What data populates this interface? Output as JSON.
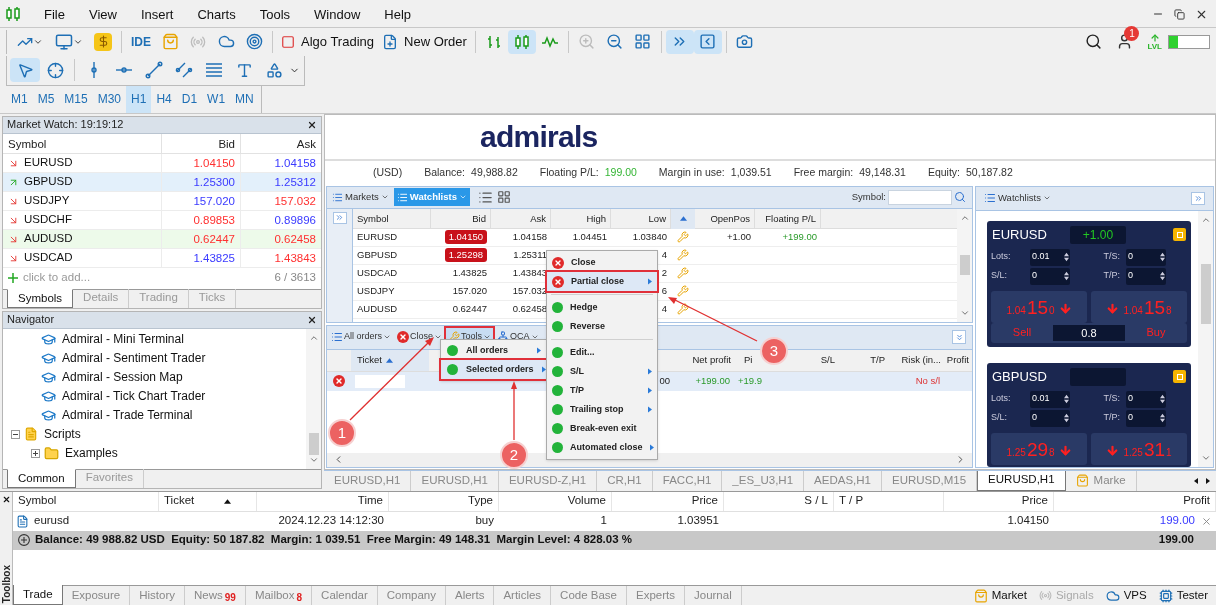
{
  "menu_bar": {
    "items": [
      "File",
      "View",
      "Insert",
      "Charts",
      "Tools",
      "Window",
      "Help"
    ]
  },
  "toolbar": {
    "ide": "IDE",
    "algo_trading": "Algo Trading",
    "new_order": "New Order",
    "signals_disabled": true,
    "zoom_in_disabled": true,
    "chart_types": [
      {
        "selected": false
      },
      {
        "selected": true
      },
      {
        "selected": false
      }
    ],
    "auto_scroll_on": true,
    "chart_shift_on": true
  },
  "account_badge": "1",
  "lvl_label": "LVL",
  "level_meter": {
    "level": 0.22
  },
  "draw_tools": [
    {
      "selected": true
    },
    {
      "selected": false
    },
    {
      "selected": false
    },
    {
      "selected": false
    },
    {
      "selected": false
    },
    {
      "selected": false
    },
    {
      "selected": false
    },
    {
      "selected": false
    },
    {
      "selected": false
    }
  ],
  "timeframes": [
    {
      "label": "M1",
      "selected": false
    },
    {
      "label": "M5",
      "selected": false
    },
    {
      "label": "M15",
      "selected": false
    },
    {
      "label": "M30",
      "selected": false
    },
    {
      "label": "H1",
      "selected": true
    },
    {
      "label": "H4",
      "selected": false
    },
    {
      "label": "D1",
      "selected": false
    },
    {
      "label": "W1",
      "selected": false
    },
    {
      "label": "MN",
      "selected": false
    }
  ],
  "market_watch": {
    "title": "Market Watch: 19:19:12",
    "columns": [
      "Symbol",
      "Bid",
      "Ask"
    ],
    "rows": [
      {
        "symbol": "EURUSD",
        "bid": "1.04150",
        "ask": "1.04158",
        "rising": false,
        "bid_up": false,
        "ask_up": true,
        "selected": false,
        "highlighted": false
      },
      {
        "symbol": "GBPUSD",
        "bid": "1.25300",
        "ask": "1.25312",
        "rising": true,
        "bid_up": true,
        "ask_up": true,
        "selected": true,
        "highlighted": false
      },
      {
        "symbol": "USDJPY",
        "bid": "157.020",
        "ask": "157.032",
        "rising": false,
        "bid_up": true,
        "ask_up": false,
        "selected": false,
        "highlighted": false
      },
      {
        "symbol": "USDCHF",
        "bid": "0.89853",
        "ask": "0.89896",
        "rising": false,
        "bid_up": false,
        "ask_up": true,
        "selected": false,
        "highlighted": false
      },
      {
        "symbol": "AUDUSD",
        "bid": "0.62447",
        "ask": "0.62458",
        "rising": false,
        "bid_up": false,
        "ask_up": false,
        "selected": false,
        "highlighted": true
      },
      {
        "symbol": "USDCAD",
        "bid": "1.43825",
        "ask": "1.43843",
        "rising": false,
        "bid_up": true,
        "ask_up": false,
        "selected": false,
        "highlighted": false
      }
    ],
    "add_row": "click to add...",
    "count": "6 / 3613",
    "tabs": [
      {
        "label": "Symbols",
        "selected": true
      },
      {
        "label": "Details",
        "selected": false
      },
      {
        "label": "Trading",
        "selected": false
      },
      {
        "label": "Ticks",
        "selected": false
      }
    ]
  },
  "navigator": {
    "title": "Navigator",
    "tree": [
      {
        "label": "Admiral - Mini Terminal",
        "kind": "app"
      },
      {
        "label": "Admiral - Sentiment Trader",
        "kind": "app"
      },
      {
        "label": "Admiral - Session Map",
        "kind": "app"
      },
      {
        "label": "Admiral - Tick Chart Trader",
        "kind": "app"
      },
      {
        "label": "Admiral - Trade Terminal",
        "kind": "app"
      },
      {
        "label": "Scripts",
        "kind": "scripts",
        "expanded": true,
        "children": [
          {
            "label": "Examples",
            "kind": "folder",
            "expanded": false
          }
        ]
      }
    ],
    "tabs": [
      {
        "label": "Common",
        "selected": true
      },
      {
        "label": "Favorites",
        "selected": false
      }
    ]
  },
  "terminal": {
    "logo": "admirals",
    "currency": "(USD)",
    "summary": [
      {
        "label": "Balance:",
        "value": "49,988.82",
        "positive": false
      },
      {
        "label": "Floating P/L:",
        "value": "199.00",
        "positive": true
      },
      {
        "label": "Margin in use:",
        "value": "1,039.51",
        "positive": false
      },
      {
        "label": "Free margin:",
        "value": "49,148.31",
        "positive": false
      },
      {
        "label": "Equity:",
        "value": "50,187.82",
        "positive": false
      }
    ],
    "watchlist": {
      "buttons": [
        {
          "label": "Markets",
          "selected": false
        },
        {
          "label": "Watchlists",
          "selected": true
        }
      ],
      "symbol_label": "Symbol:",
      "columns": [
        "Symbol",
        "Bid",
        "Ask",
        "High",
        "Low",
        "OpenPos",
        "Floating P/L"
      ],
      "rows": [
        {
          "symbol": "EURUSD",
          "bid": "1.04150",
          "flash": true,
          "ask": "1.04158",
          "high": "1.04451",
          "low": "1.03840",
          "open_pos": "+1.00",
          "floating_pl": "+199.00"
        },
        {
          "symbol": "GBPUSD",
          "bid": "1.25298",
          "flash": true,
          "ask": "1.25311",
          "low": "4"
        },
        {
          "symbol": "USDCAD",
          "bid": "1.43825",
          "flash": false,
          "ask": "1.43843",
          "low": "2"
        },
        {
          "symbol": "USDJPY",
          "bid": "157.020",
          "flash": false,
          "ask": "157.032",
          "low": "6"
        },
        {
          "symbol": "AUDUSD",
          "bid": "0.62447",
          "flash": false,
          "ask": "0.62458",
          "low": "4"
        }
      ]
    },
    "orders": {
      "toolbar": [
        {
          "label": "All orders",
          "kind": "list",
          "selected": false
        },
        {
          "label": "Close",
          "kind": "close",
          "selected": false
        },
        {
          "label": "Tools",
          "kind": "tools",
          "selected": true
        },
        {
          "label": "OCA",
          "kind": "oca",
          "selected": false
        }
      ],
      "columns": [
        "Ticket",
        "Net profit",
        "Pi",
        "S/L",
        "T/P",
        "Risk (in...",
        "Profit"
      ],
      "rows": [
        {
          "column_3_value": "00",
          "net_profit": "+199.00",
          "pips": "+19.9",
          "risk": "No s/l"
        }
      ]
    },
    "tools_menu": [
      {
        "label": "All orders",
        "selected": false,
        "submenu": true
      },
      {
        "label": "Selected orders",
        "selected": true,
        "submenu": true
      }
    ],
    "order_menu": [
      {
        "kind": "close",
        "label": "Close",
        "submenu": false,
        "selected": false
      },
      {
        "kind": "close",
        "label": "Partial close",
        "submenu": true,
        "selected": true
      },
      {
        "kind": "separator"
      },
      {
        "kind": "action",
        "label": "Hedge",
        "submenu": false,
        "selected": false
      },
      {
        "kind": "action",
        "label": "Reverse",
        "submenu": false,
        "selected": false
      },
      {
        "kind": "separator"
      },
      {
        "kind": "action",
        "label": "Edit...",
        "submenu": false,
        "selected": false
      },
      {
        "kind": "action",
        "label": "S/L",
        "submenu": true,
        "selected": false
      },
      {
        "kind": "action",
        "label": "T/P",
        "submenu": true,
        "selected": false
      },
      {
        "kind": "action",
        "label": "Trailing stop",
        "submenu": true,
        "selected": false
      },
      {
        "kind": "action",
        "label": "Break-even exit",
        "submenu": false,
        "selected": false
      },
      {
        "kind": "action",
        "label": "Automated close",
        "submenu": true,
        "selected": false
      }
    ],
    "side_panel": {
      "header": "Watchlists",
      "cards": [
        {
          "symbol": "EURUSD",
          "position": "+1.00",
          "fields": [
            {
              "label": "Lots:",
              "value": "0.01"
            },
            {
              "label": "T/S:",
              "value": "0"
            },
            {
              "label": "S/L:",
              "value": "0"
            },
            {
              "label": "T/P:",
              "value": "0"
            }
          ],
          "sell": {
            "prefix": "1.04",
            "big": "15",
            "suffix": "0",
            "label": "Sell"
          },
          "buy": {
            "prefix": "1.04",
            "big": "15",
            "suffix": "8",
            "label": "Buy"
          },
          "spread": "0.8"
        },
        {
          "symbol": "GBPUSD",
          "fields": [
            {
              "label": "Lots:",
              "value": "0.01"
            },
            {
              "label": "T/S:",
              "value": "0"
            },
            {
              "label": "S/L:",
              "value": "0"
            },
            {
              "label": "T/P:",
              "value": "0"
            }
          ],
          "sell": {
            "prefix": "1.25",
            "big": "29",
            "suffix": "8"
          },
          "buy": {
            "prefix": "1.25",
            "big": "31",
            "suffix": "1"
          }
        }
      ]
    }
  },
  "chart_tabs": [
    {
      "label": "EURUSD,H1",
      "kind": "chart",
      "selected": false
    },
    {
      "label": "EURUSD,H1",
      "kind": "chart",
      "selected": false
    },
    {
      "label": "EURUSD-Z,H1",
      "kind": "chart",
      "selected": false
    },
    {
      "label": "CR,H1",
      "kind": "chart",
      "selected": false
    },
    {
      "label": "FACC,H1",
      "kind": "chart",
      "selected": false
    },
    {
      "label": "_ES_U3,H1",
      "kind": "chart",
      "selected": false
    },
    {
      "label": "AEDAS,H1",
      "kind": "chart",
      "selected": false
    },
    {
      "label": "EURUSD,M15",
      "kind": "chart",
      "selected": false
    },
    {
      "label": "EURUSD,H1",
      "kind": "chart",
      "selected": true
    },
    {
      "label": "Marke",
      "kind": "market",
      "selected": false
    }
  ],
  "toolbox": {
    "title": "Toolbox",
    "columns": [
      "Symbol",
      "Ticket",
      "Time",
      "Type",
      "Volume",
      "Price",
      "S / L",
      "T / P",
      "Price",
      "Profit"
    ],
    "rows": [
      {
        "symbol": "eurusd",
        "time": "2024.12.23 14:12:30",
        "type": "buy",
        "volume": "1",
        "open_price": "1.03951",
        "current_price": "1.04150",
        "profit": "199.00"
      }
    ],
    "summary": "Balance: 49 988.82 USD  Equity: 50 187.82  Margin: 1 039.51  Free Margin: 49 148.31  Margin Level: 4 828.03 %",
    "summary_profit": "199.00",
    "tabs": [
      {
        "label": "Trade",
        "selected": true
      },
      {
        "label": "Exposure",
        "selected": false
      },
      {
        "label": "History",
        "selected": false
      },
      {
        "label": "News",
        "count": "99",
        "selected": false
      },
      {
        "label": "Mailbox",
        "count": "8",
        "selected": false
      },
      {
        "label": "Calendar",
        "selected": false
      },
      {
        "label": "Company",
        "selected": false
      },
      {
        "label": "Alerts",
        "selected": false
      },
      {
        "label": "Articles",
        "selected": false
      },
      {
        "label": "Code Base",
        "selected": false
      },
      {
        "label": "Experts",
        "selected": false
      },
      {
        "label": "Journal",
        "selected": false
      }
    ],
    "services": [
      {
        "label": "Market",
        "kind": "market",
        "disabled": false
      },
      {
        "label": "Signals",
        "kind": "signals",
        "disabled": true
      },
      {
        "label": "VPS",
        "kind": "vps",
        "disabled": false
      },
      {
        "label": "Tester",
        "kind": "tester",
        "disabled": false
      }
    ]
  },
  "annotations": [
    {
      "label": "1"
    },
    {
      "label": "2"
    },
    {
      "label": "3"
    }
  ]
}
